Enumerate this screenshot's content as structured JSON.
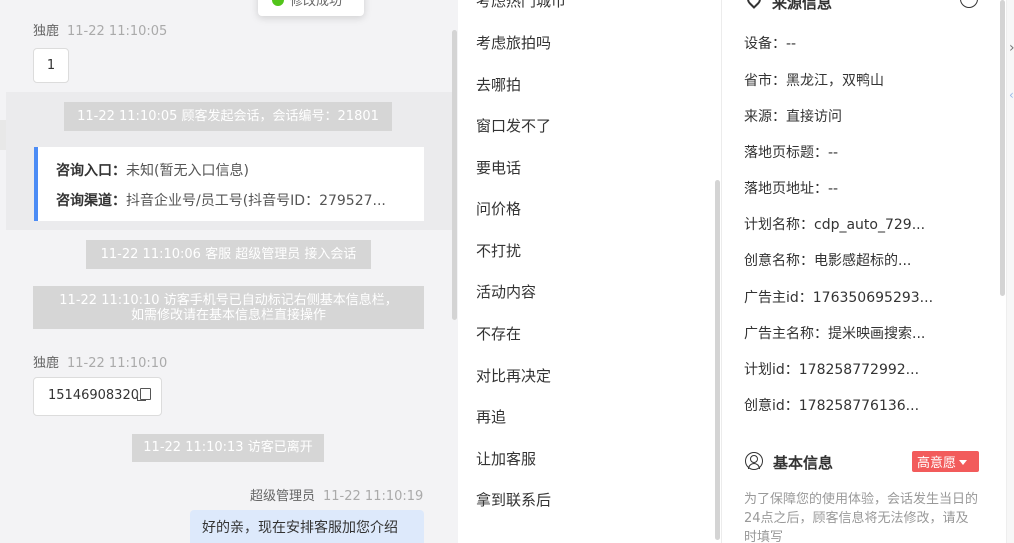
{
  "toast": {
    "text": "修改成功"
  },
  "chat": {
    "messages": [
      {
        "sender": "独鹿",
        "time": "11-22 11:10:05",
        "content": "1"
      },
      {
        "sender": "独鹿",
        "time": "11-22 11:10:10",
        "content": "15146908320"
      },
      {
        "sender": "超级管理员",
        "time": "11-22 11:10:19",
        "content": "好的亲，现在安排客服加您介绍"
      }
    ],
    "system": [
      "11-22 11:10:05 顾客发起会话，会话编号：21801",
      "11-22 11:10:06 客服 超级管理员 接入会话",
      "11-22 11:10:10 访客手机号已自动标记右侧基本信息栏，",
      "如需修改请在基本信息栏直接操作",
      "11-22 11:10:13 访客已离开"
    ],
    "card": {
      "entry_label": "咨询入口：",
      "entry_value": "未知(暂无入口信息)",
      "channel_label": "咨询渠道：",
      "channel_value": "抖音企业号/员工号(抖音号ID：279527..."
    }
  },
  "reasons": {
    "items": [
      "考虑热门城市",
      "考虑旅拍吗",
      "去哪拍",
      "窗口发不了",
      "要电话",
      "问价格",
      "不打扰",
      "活动内容",
      "不存在",
      "对比再决定",
      "再追",
      "让加客服",
      "拿到联系后"
    ]
  },
  "source": {
    "title": "来源信息",
    "fields": [
      "设备：--",
      "省市：黑龙江，双鸭山",
      "来源：直接访问",
      "落地页标题：--",
      "落地页地址：--",
      "计划名称：cdp_auto_729...",
      "创意名称：电影感超标的...",
      "广告主id：176350695293...",
      "广告主名称：提米映画搜索...",
      "计划id：178258772992...",
      "创意id：178258776136..."
    ]
  },
  "basic": {
    "title": "基本信息",
    "intent_tag": "高意愿",
    "note": "为了保障您的使用体验，会话发生当日的24点之后，顾客信息将无法修改，请及时填写"
  },
  "colors": {
    "accent": "#4c8cf5",
    "tag": "#f25b5b",
    "system_bg": "#d6d6d6"
  }
}
